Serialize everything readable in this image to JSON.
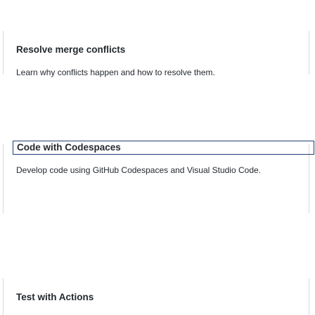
{
  "cards": [
    {
      "title": "Resolve merge conflicts",
      "description": "Learn why conflicts happen and how to resolve them."
    },
    {
      "title": "Code with Codespaces",
      "description": "Develop code using GitHub Codespaces and Visual Studio Code."
    },
    {
      "title": "Test with Actions",
      "description": ""
    }
  ]
}
